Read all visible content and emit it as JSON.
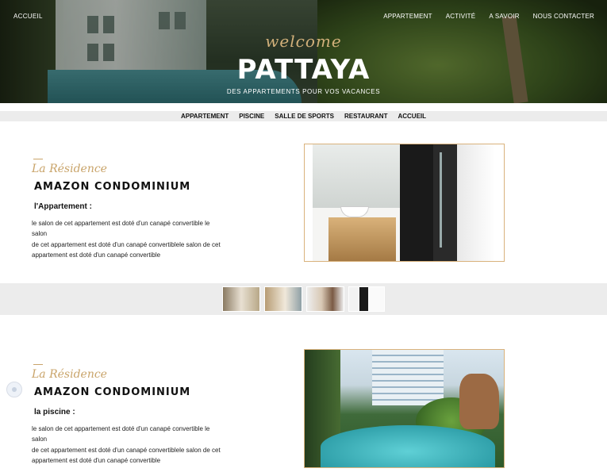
{
  "header": {
    "home_label": "ACCUEIL",
    "nav": [
      "APPARTEMENT",
      "ACTIVITÉ",
      "A SAVOIR",
      "NOUS CONTACTER"
    ],
    "welcome": "welcome",
    "title": "PATTAYA",
    "subtitle": "DES APPARTEMENTS POUR VOS VACANCES"
  },
  "subnav": [
    "APPARTEMENT",
    "PISCINE",
    "SALLE DE SPORTS",
    "RESTAURANT",
    "ACCUEIL"
  ],
  "sections": [
    {
      "script_title": "La Résidence",
      "heading": "AMAZON CONDOMINIUM",
      "subheading": "l'Appartement :",
      "lines": [
        "le salon de cet appartement est doté d'un canapé convertible le salon",
        "de cet appartement est doté d'un canapé convertiblele salon de cet",
        "appartement est doté d'un canapé convertible"
      ],
      "image_icon": "bathroom-photo"
    },
    {
      "script_title": "La Résidence",
      "heading": "AMAZON CONDOMINIUM",
      "subheading": "la piscine :",
      "lines": [
        "le salon de cet appartement est doté d'un canapé convertible le salon",
        "de cet appartement est doté d'un canapé convertiblele salon de cet",
        "appartement est doté d'un canapé convertible"
      ],
      "image_icon": "pool-photo"
    }
  ],
  "thumbnails": [
    "bedroom-thumb-1",
    "bedroom-thumb-2",
    "bedroom-thumb-3",
    "bathroom-thumb"
  ],
  "colors": {
    "accent": "#c9a46a",
    "strip_bg": "#ececec"
  }
}
